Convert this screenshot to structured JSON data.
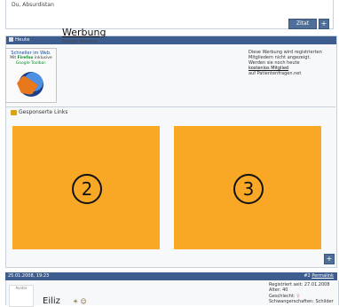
{
  "top_post": {
    "truncated_text": "Du, Absurdistan",
    "quote_button": "Zitat",
    "plus_button": "+"
  },
  "ad_post": {
    "header": "Heute",
    "ad_image": {
      "line1": "Schneller im Web.",
      "line2_prefix": "Mit ",
      "line2_brand": "Firefox",
      "line2_suffix": " inklusive",
      "line3": "Google Toolbar."
    },
    "title": "Werbung",
    "subtitle": "Google Adsense",
    "notice_lines": [
      "Diese Werbung wird registrierten",
      "Mitgliedern nicht angezeigt.",
      "Werden sie noch heute"
    ],
    "notice_link": "kostenlos Mitglied",
    "notice_tail": "auf Patientenfragen.net",
    "sponsored_label": "Gesponserte Links",
    "slot_2_label": "2",
    "slot_3_label": "3",
    "plus_button": "+"
  },
  "bottom_post": {
    "date": "25.01.2008, 19:23",
    "post_number": "#2",
    "permalink": "Permalink",
    "avatar_label": "Avatar",
    "username": "Eiliz",
    "user_icons": "☀ ☺",
    "info": {
      "registered": "Registriert seit: 27.01.2008",
      "age": "Alter: 40",
      "gender_label": "Geschlecht:",
      "gender_icon": "♀",
      "pregnancy": "Schwangerschaften: Schilder"
    }
  },
  "colors": {
    "header_blue": "#3d5d8f",
    "ad_orange": "#f9a825",
    "button_blue": "#4f6f99"
  }
}
